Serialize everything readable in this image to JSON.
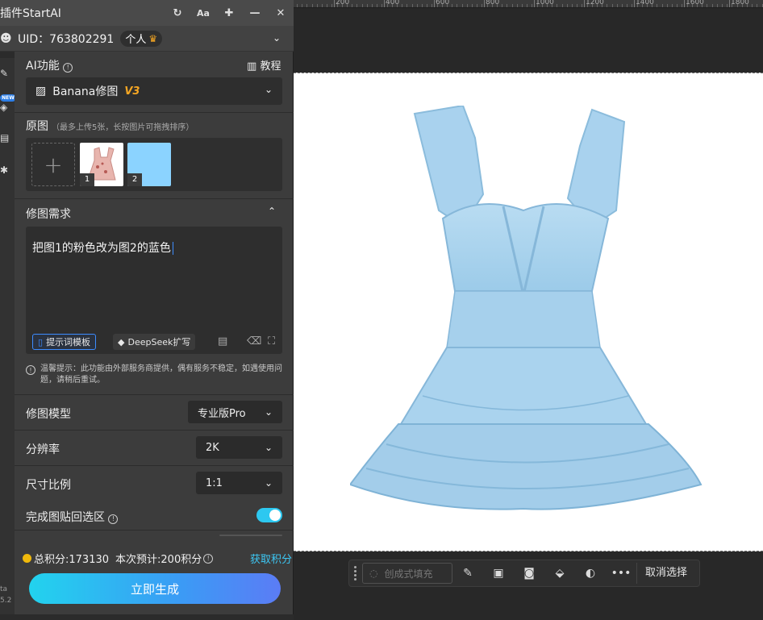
{
  "app": {
    "title": "插件StartAI",
    "uid_text": "UID：763802291",
    "plan_label": "个人"
  },
  "ai_function": {
    "label": "AI功能",
    "tutorial_label": "教程",
    "selected_model": "Banana修图",
    "version_tag": "V3"
  },
  "source_images": {
    "label": "原图",
    "note": "（最多上传5张，长按图片可拖拽排序）",
    "items": [
      {
        "index": "1",
        "desc": "pink floral dress"
      },
      {
        "index": "2",
        "color": "#8bd3ff"
      }
    ]
  },
  "edit_request": {
    "label": "修图需求",
    "prompt_value": "把图1的粉色改为图2的蓝色",
    "template_button": "提示词模板",
    "deepseek_button": "DeepSeek扩写"
  },
  "notice": "温馨提示：此功能由外部服务商提供，偶有服务不稳定，如遇使用问题，请稍后重试。",
  "settings": {
    "model": {
      "label": "修图模型",
      "value": "专业版Pro"
    },
    "resolution": {
      "label": "分辨率",
      "value": "2K"
    },
    "aspect_ratio": {
      "label": "尺寸比例",
      "value": "1:1"
    },
    "paste_back": {
      "label": "完成图贴回选区",
      "enabled": true
    }
  },
  "points": {
    "total": "总积分:173130",
    "estimate": "本次预计:200积分",
    "get_points": "获取积分"
  },
  "generate_button": "立即生成",
  "ruler": {
    "labels": [
      "200",
      "400",
      "600",
      "800",
      "1000",
      "1200",
      "1400",
      "1600",
      "1800"
    ]
  },
  "taskbar": {
    "generative_fill": "创成式填充",
    "deselect": "取消选择"
  },
  "left_strip": {
    "new_badge": "NEW",
    "bottom_text_1": "ta",
    "bottom_text_2": "5.2"
  },
  "colors": {
    "accent": "#2dc8f0",
    "version": "#f5a623",
    "dress": "#a9d1ec"
  }
}
